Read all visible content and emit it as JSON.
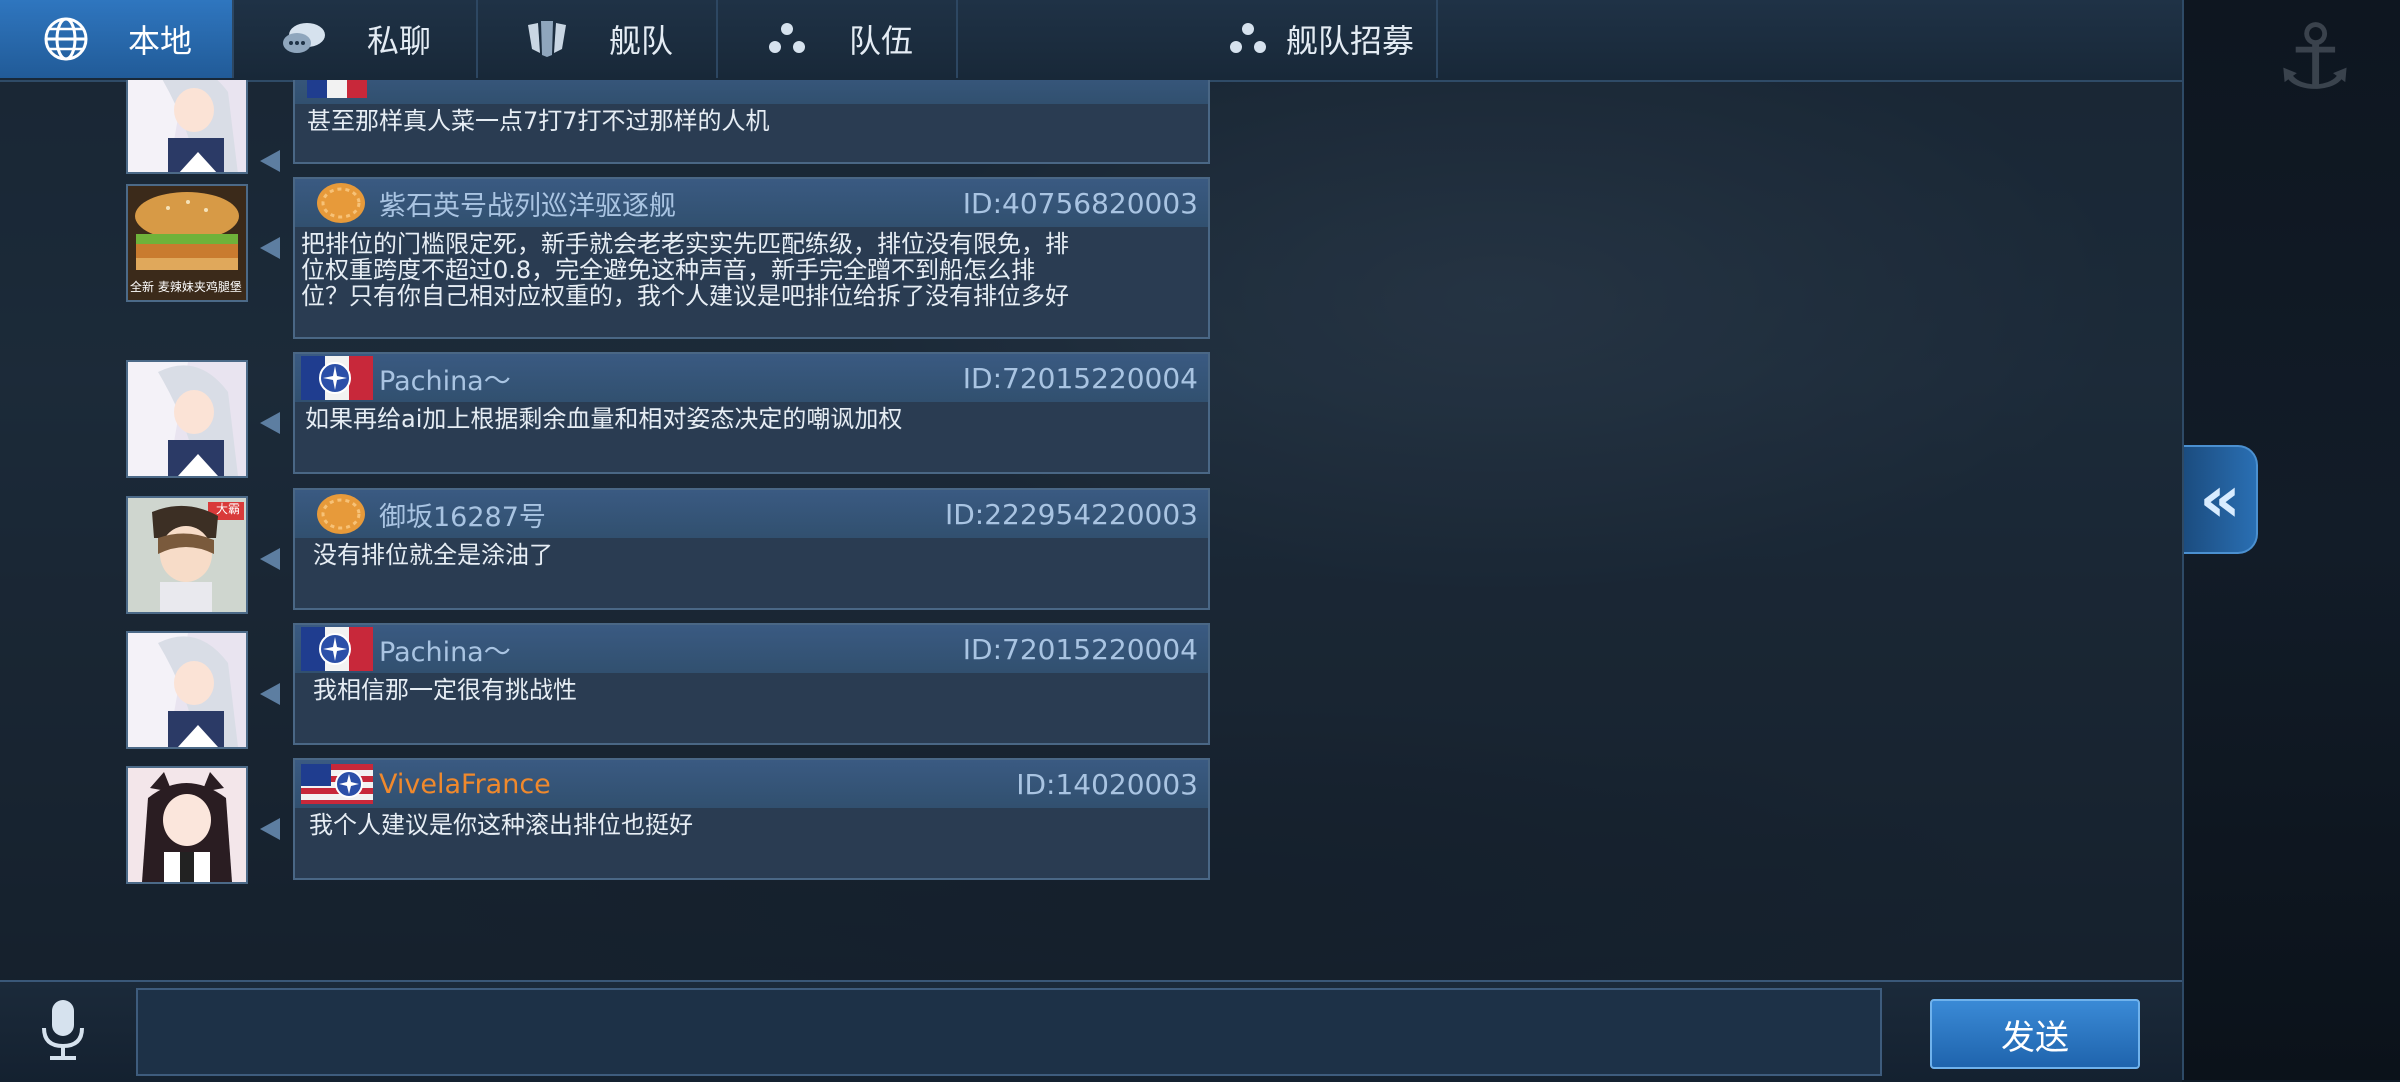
{
  "tabs": [
    {
      "label": "本地",
      "icon": "globe-icon",
      "active": true
    },
    {
      "label": "私聊",
      "icon": "chat-bubbles-icon",
      "active": false
    },
    {
      "label": "舰队",
      "icon": "fleet-shield-icon",
      "active": false
    },
    {
      "label": "队伍",
      "icon": "team-icon",
      "active": false
    },
    {
      "label": "舰队招募",
      "icon": "recruit-icon",
      "active": false
    }
  ],
  "messages": [
    {
      "name": "",
      "id": "",
      "text": "甚至那样真人菜一点7打7打不过那样的人机",
      "flag": "france-flag-icon",
      "avatar": "anime-girl-avatar"
    },
    {
      "name": "紫石英号战列巡洋驱逐舰",
      "id": "ID:40756820003",
      "text": "把排位的门槛限定死，新手就会老老实实先匹配练级，排位没有限免，排位权重跨度不超过0.8，完全避免这种声音，新手完全蹭不到船怎么排位？只有你自己相对应权重的，我个人建议是吧排位给拆了没有排位多好",
      "flag": "cookie-badge-icon",
      "avatar": "burger-avatar",
      "avatar_caption": "全新 麦辣妹夹鸡腿堡"
    },
    {
      "name": "Pachina～",
      "id": "ID:72015220004",
      "text": "如果再给ai加上根据剩余血量和相对姿态决定的嘲讽加权",
      "flag": "france-flag-icon",
      "avatar": "anime-girl-avatar"
    },
    {
      "name": "御坂16287号",
      "id": "ID:222954220003",
      "text": "没有排位就全是涂油了",
      "flag": "cookie-badge-icon",
      "avatar": "misaka-avatar",
      "avatar_caption": "大霸"
    },
    {
      "name": "Pachina～",
      "id": "ID:72015220004",
      "text": "我相信那一定很有挑战性",
      "flag": "france-flag-icon",
      "avatar": "anime-girl-avatar"
    },
    {
      "name": "VivelaFrance",
      "id": "ID:14020003",
      "text": "我个人建议是你这种滚出排位也挺好",
      "flag": "us-flag-icon",
      "avatar": "catgirl-avatar",
      "name_color": "#f0892c"
    }
  ],
  "input": {
    "value": ""
  },
  "send_label": "发送",
  "colors": {
    "accent": "#2f76bf",
    "name_blue": "#a9c4e2",
    "name_orange": "#f0892c",
    "bubble_bg": "#2a3c52"
  }
}
